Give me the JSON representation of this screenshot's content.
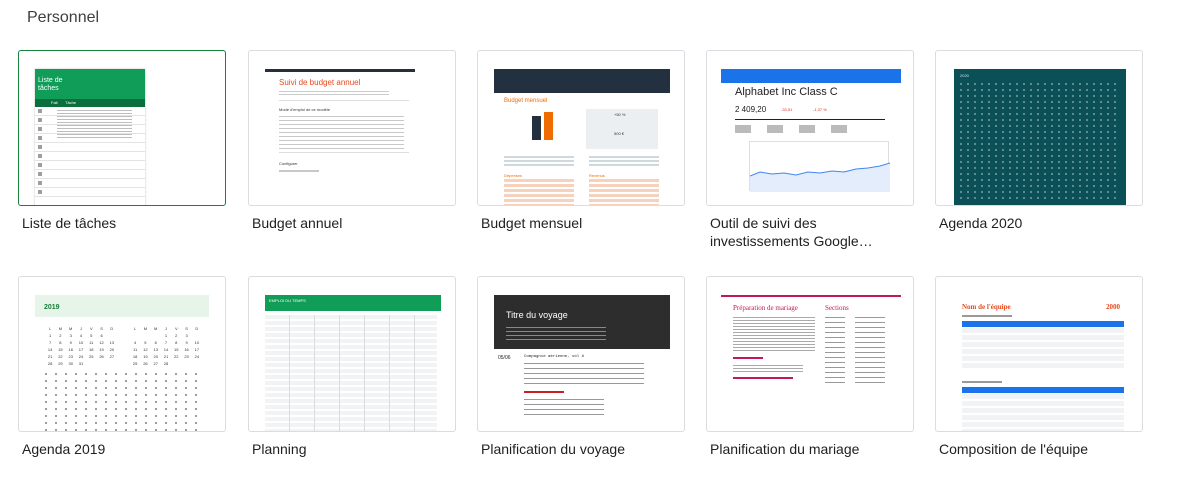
{
  "section": {
    "title": "Personnel"
  },
  "templates": [
    {
      "id": "todo",
      "label": "Liste de tâches",
      "preview": {
        "title": "Liste de tâches",
        "col1": "Fait",
        "col2": "Tâche"
      }
    },
    {
      "id": "annual-budget",
      "label": "Budget annuel",
      "preview": {
        "title": "Suivi de budget annuel",
        "steps_title": "Mode d'emploi de ce modèle",
        "config_title": "Configurer"
      }
    },
    {
      "id": "monthly-budget",
      "label": "Budget mensuel",
      "preview": {
        "title": "Budget mensuel",
        "pct": "+50 %",
        "amount": "500 €",
        "expenses": "Dépenses",
        "income": "Revenus"
      }
    },
    {
      "id": "invest",
      "label": "Outil de suivi des investissements Google…",
      "preview": {
        "title": "Alphabet Inc Class C",
        "price": "2 409,20",
        "change": "-33,51",
        "change_pct": "-1,37 %"
      }
    },
    {
      "id": "agenda-2020",
      "label": "Agenda 2020",
      "preview": {
        "year": "2020"
      }
    },
    {
      "id": "agenda-2019",
      "label": "Agenda 2019",
      "preview": {
        "year": "2019",
        "day_headers": [
          "L",
          "M",
          "M",
          "J",
          "V",
          "S",
          "D"
        ],
        "january_rows": [
          [
            "1",
            "2",
            "3",
            "4",
            "5",
            "6",
            ""
          ],
          [
            "7",
            "8",
            "9",
            "10",
            "11",
            "12",
            "13"
          ],
          [
            "14",
            "15",
            "16",
            "17",
            "18",
            "19",
            "20"
          ],
          [
            "21",
            "22",
            "23",
            "24",
            "25",
            "26",
            "27"
          ],
          [
            "28",
            "29",
            "30",
            "31",
            "",
            "",
            ""
          ]
        ],
        "february_rows": [
          [
            "",
            "",
            "",
            "1",
            "2",
            "3",
            ""
          ],
          [
            "4",
            "5",
            "6",
            "7",
            "8",
            "9",
            "10"
          ],
          [
            "11",
            "12",
            "13",
            "14",
            "15",
            "16",
            "17"
          ],
          [
            "18",
            "19",
            "20",
            "21",
            "22",
            "23",
            "24"
          ],
          [
            "25",
            "26",
            "27",
            "28",
            "",
            "",
            ""
          ]
        ]
      }
    },
    {
      "id": "planning",
      "label": "Planning",
      "preview": {
        "title": "EMPLOI DU TEMPS"
      }
    },
    {
      "id": "trip",
      "label": "Planification du voyage",
      "preview": {
        "title": "Titre du voyage",
        "date": "05/06",
        "flight": "Compagnie aérienne, vol #"
      }
    },
    {
      "id": "wedding",
      "label": "Planification du mariage",
      "preview": {
        "title": "Préparation de mariage",
        "sections": "Sections"
      }
    },
    {
      "id": "team",
      "label": "Composition de l'équipe",
      "preview": {
        "title": "Nom de l'équipe",
        "year": "2000"
      }
    }
  ],
  "colors": {
    "green": "#188038",
    "sheet_green": "#0f9d58",
    "teal": "#0b4f57",
    "orange": "#ef6c00",
    "navy": "#23303f",
    "blue": "#1a73e8",
    "magenta": "#c2185b",
    "red_orange": "#e8491d"
  }
}
